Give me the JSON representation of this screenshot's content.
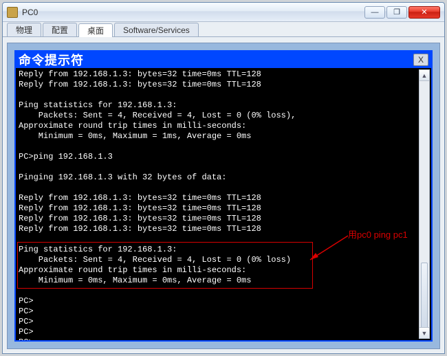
{
  "window": {
    "title": "PC0"
  },
  "winbuttons": {
    "min": "—",
    "max": "❐",
    "close": "✕"
  },
  "tabs": {
    "items": [
      "物理",
      "配置",
      "桌面",
      "Software/Services"
    ],
    "activeIndex": 2
  },
  "prompt": {
    "title": "命令提示符",
    "close_x": "X"
  },
  "terminal": {
    "lines": [
      "Reply from 192.168.1.3: bytes=32 time=0ms TTL=128",
      "Reply from 192.168.1.3: bytes=32 time=0ms TTL=128",
      "",
      "Ping statistics for 192.168.1.3:",
      "    Packets: Sent = 4, Received = 4, Lost = 0 (0% loss),",
      "Approximate round trip times in milli-seconds:",
      "    Minimum = 0ms, Maximum = 1ms, Average = 0ms",
      "",
      "PC>ping 192.168.1.3",
      "",
      "Pinging 192.168.1.3 with 32 bytes of data:",
      "",
      "Reply from 192.168.1.3: bytes=32 time=0ms TTL=128",
      "Reply from 192.168.1.3: bytes=32 time=0ms TTL=128",
      "Reply from 192.168.1.3: bytes=32 time=0ms TTL=128",
      "Reply from 192.168.1.3: bytes=32 time=0ms TTL=128",
      "",
      "Ping statistics for 192.168.1.3:",
      "    Packets: Sent = 4, Received = 4, Lost = 0 (0% loss)",
      "Approximate round trip times in milli-seconds:",
      "    Minimum = 0ms, Maximum = 0ms, Average = 0ms",
      "",
      "PC>",
      "PC>",
      "PC>",
      "PC>",
      "PC>"
    ]
  },
  "annotation": {
    "text": "用pc0 ping pc1"
  },
  "scrollbar": {
    "up": "▲",
    "down": "▼"
  }
}
